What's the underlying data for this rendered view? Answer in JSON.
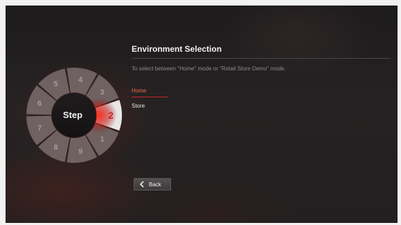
{
  "wheel": {
    "center_label": "Step",
    "current_step": "2",
    "steps": [
      "3",
      "4",
      "5",
      "6",
      "7",
      "8",
      "9",
      "1"
    ]
  },
  "page": {
    "title": "Environment Selection",
    "description": "To select between \"Home\" mode or \"Retail Store Demo\" mode."
  },
  "options": [
    {
      "label": "Home",
      "selected": true
    },
    {
      "label": "Store",
      "selected": false
    }
  ],
  "back_button": {
    "label": "Back",
    "icon": "chevron-left-icon"
  },
  "colors": {
    "accent": "#c7252a",
    "selected_text": "#f06a4d"
  }
}
